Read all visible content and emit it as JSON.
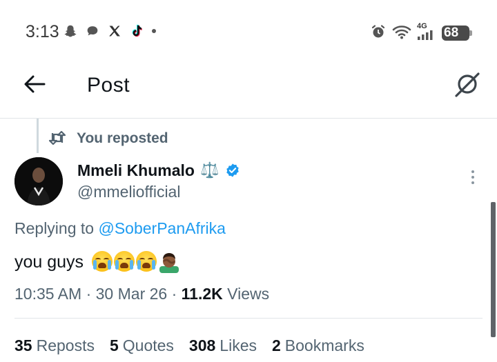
{
  "status_bar": {
    "time": "3:13",
    "left_icons": [
      "snapchat-icon",
      "chat-bubble-icon",
      "x-icon",
      "tiktok-icon"
    ],
    "right_icons": [
      "alarm-icon",
      "wifi-icon",
      "cellular-signal-icon"
    ],
    "network_label": "4G",
    "battery": "68"
  },
  "header": {
    "title": "Post",
    "back_icon": "arrow-left-icon",
    "grok_icon": "grok-icon"
  },
  "post": {
    "repost_context": "You reposted",
    "author": {
      "name": "Mmeli Khumalo",
      "name_emoji": "⚖️",
      "handle": "@mmeliofficial",
      "verified": true,
      "verified_color": "#1d9bf0"
    },
    "reply_prefix": "Replying to",
    "reply_to": "@SoberPanAfrika",
    "text": "you guys",
    "emojis": [
      "loudly-crying-face",
      "loudly-crying-face",
      "loudly-crying-face",
      "person-facepalming-medium-dark"
    ],
    "time": "10:35 AM",
    "date": "30 Mar 26",
    "views_count": "11.2K",
    "views_label": "Views",
    "stats": [
      {
        "count": "35",
        "label": "Reposts"
      },
      {
        "count": "5",
        "label": "Quotes"
      },
      {
        "count": "308",
        "label": "Likes"
      },
      {
        "count": "2",
        "label": "Bookmarks"
      }
    ]
  },
  "colors": {
    "link": "#1d9bf0",
    "secondary_text": "#536471",
    "primary_text": "#0f1419"
  }
}
